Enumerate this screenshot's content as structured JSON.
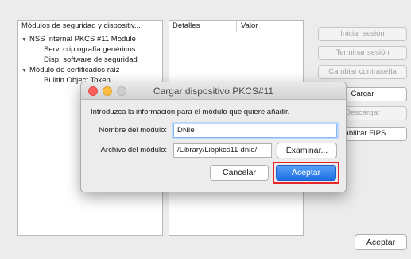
{
  "tree": {
    "header": "Módulos de seguridad y dispositiv...",
    "items": [
      {
        "label": "NSS Internal PKCS #11 Module",
        "indent": 0,
        "expanded": true
      },
      {
        "label": "Serv. criptografía genéricos",
        "indent": 1
      },
      {
        "label": "Disp. software de seguridad",
        "indent": 1
      },
      {
        "label": "Módulo de certificados raíz",
        "indent": 0,
        "expanded": true
      },
      {
        "label": "Builtin Object Token",
        "indent": 1
      }
    ]
  },
  "details": {
    "col_details": "Detalles",
    "col_value": "Valor"
  },
  "side_buttons": {
    "login": "Iniciar sesión",
    "logout": "Terminar sesión",
    "change_password": "Cambiar contraseña",
    "load": "Cargar",
    "unload": "Descargar",
    "fips": "Habilitar FIPS"
  },
  "main_ok": "Aceptar",
  "dialog": {
    "title": "Cargar dispositivo PKCS#11",
    "prompt": "Introduzca la información para el módulo que quiere añadir.",
    "module_name_label": "Nombre del módulo:",
    "module_name_value": "DNIe",
    "module_file_label": "Archivo del módulo:",
    "module_file_value": "/Library/Libpkcs11-dnie/",
    "browse": "Examinar...",
    "cancel": "Cancelar",
    "accept": "Aceptar"
  },
  "colors": {
    "accent": "#1e6fe6",
    "highlight_border": "#e8262a",
    "close_light": "#fc605c",
    "minimize_light": "#fdbc40"
  }
}
